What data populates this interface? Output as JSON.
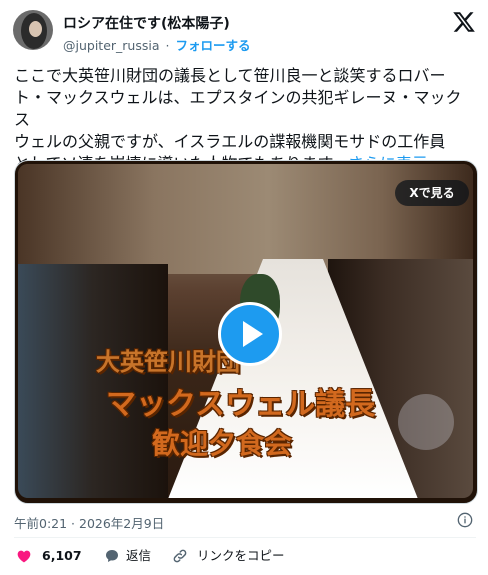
{
  "author": {
    "display_name": "ロシア在住です(松本陽子)",
    "handle": "@jupiter_russia",
    "separator": "·",
    "follow_label": "フォローする"
  },
  "post": {
    "text": "ここで大英笹川財団の議長として笹川良一と談笑するロバー\nト・マックスウェルは、エプスタインの共犯ギレーヌ・マックス\nウェルの父親ですが、イスラエルの諜報機関モサドの工作員\nとしてソ連を崩壊に導いた人物でもあります。",
    "show_more": "さらに表示"
  },
  "media": {
    "see_on_x_label": "Xで見る",
    "caption_lines": [
      "大英笹川財団",
      "マックスウェル議長",
      "歓迎夕食会"
    ]
  },
  "meta": {
    "timestamp": "午前0:21 · 2026年2月9日"
  },
  "actions": {
    "like_count": "6,107",
    "reply_label": "返信",
    "copy_link_label": "リンクをコピー"
  },
  "colors": {
    "accent": "#1d9bf0",
    "like": "#f91880",
    "secondary_text": "#536471"
  }
}
